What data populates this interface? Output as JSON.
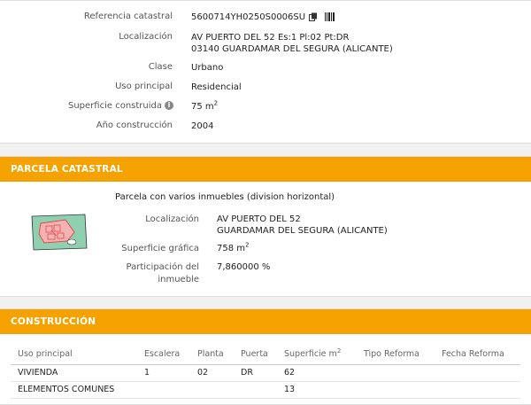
{
  "inmueble": {
    "referencia_label": "Referencia catastral",
    "referencia_value": "5600714YH0250S0006SU",
    "localizacion_label": "Localización",
    "localizacion_line1": "AV PUERTO DEL 52 Es:1 Pl:02 Pt:DR",
    "localizacion_line2": "03140 GUARDAMAR DEL SEGURA (ALICANTE)",
    "clase_label": "Clase",
    "clase_value": "Urbano",
    "uso_label": "Uso principal",
    "uso_value": "Residencial",
    "superficie_label": "Superficie construida",
    "superficie_value": "75 m",
    "superficie_unit_sup": "2",
    "anio_label": "Año construcción",
    "anio_value": "2004"
  },
  "parcela": {
    "header": "PARCELA CATASTRAL",
    "description": "Parcela con varios inmuebles (division horizontal)",
    "localizacion_label": "Localización",
    "localizacion_line1": "AV PUERTO DEL 52",
    "localizacion_line2": "GUARDAMAR DEL SEGURA (ALICANTE)",
    "superficie_label": "Superficie gráfica",
    "superficie_value": "758 m",
    "superficie_unit_sup": "2",
    "participacion_label_line1": "Participación del",
    "participacion_label_line2": "inmueble",
    "participacion_value": "7,860000 %"
  },
  "construccion": {
    "header": "CONSTRUCCIÓN",
    "columns": [
      "Uso principal",
      "Escalera",
      "Planta",
      "Puerta",
      "Superficie m",
      "Tipo Reforma",
      "Fecha Reforma"
    ],
    "superficie_col_sup": "2",
    "rows": [
      [
        "VIVIENDA",
        "1",
        "02",
        "DR",
        "62",
        "",
        ""
      ],
      [
        "ELEMENTOS COMUNES",
        "",
        "",
        "",
        "13",
        "",
        ""
      ]
    ]
  },
  "icons": {
    "copy": "copy-icon",
    "barcode": "barcode-icon",
    "info": "info-icon"
  },
  "colors": {
    "accent": "#f5a200",
    "parcel_fill": "#8fd0b0",
    "building_outline": "#e04a4a"
  }
}
